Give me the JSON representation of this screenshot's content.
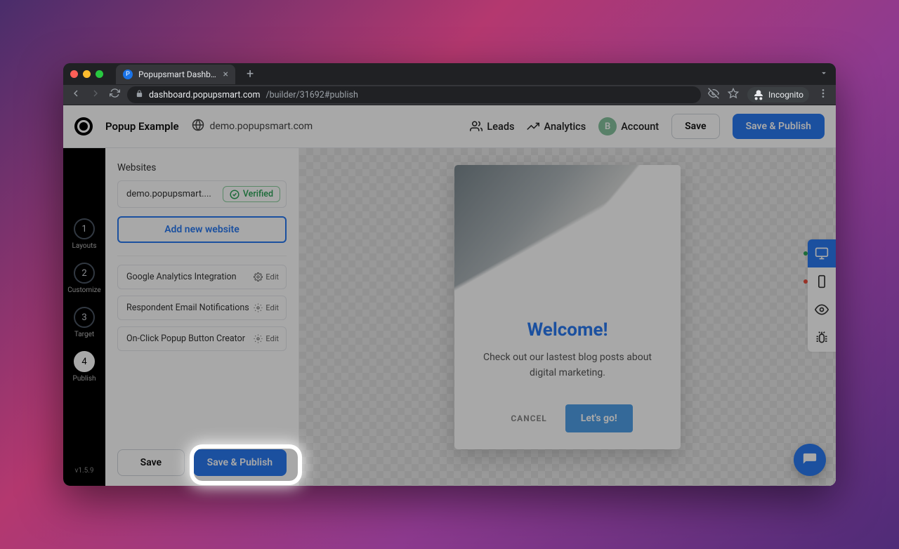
{
  "browser": {
    "tab_title": "Popupsmart Dashboard",
    "url_host": "dashboard.popupsmart.com",
    "url_path": "/builder/31692#publish",
    "incognito_label": "Incognito"
  },
  "topbar": {
    "popup_name": "Popup Example",
    "domain": "demo.popupsmart.com",
    "leads_label": "Leads",
    "analytics_label": "Analytics",
    "account_label": "Account",
    "account_initial": "B",
    "save_label": "Save",
    "save_publish_label": "Save & Publish"
  },
  "rail": {
    "steps": [
      {
        "n": "1",
        "label": "Layouts"
      },
      {
        "n": "2",
        "label": "Customize"
      },
      {
        "n": "3",
        "label": "Target"
      },
      {
        "n": "4",
        "label": "Publish"
      }
    ],
    "active_index": 3,
    "version": "v1.5.9"
  },
  "panel": {
    "title": "Websites",
    "site": "demo.popupsmart....",
    "verified_label": "Verified",
    "add_site_label": "Add new website",
    "settings": [
      {
        "label": "Google Analytics Integration",
        "edit": "Edit"
      },
      {
        "label": "Respondent Email Notifications",
        "edit": "Edit"
      },
      {
        "label": "On-Click Popup Button Creator",
        "edit": "Edit"
      }
    ],
    "footer_save": "Save",
    "footer_save_publish": "Save & Publish"
  },
  "popup": {
    "title": "Welcome!",
    "text": "Check out our lastest blog posts about digital marketing.",
    "cancel": "CANCEL",
    "cta": "Let's go!"
  }
}
